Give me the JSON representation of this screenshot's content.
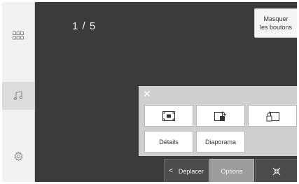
{
  "viewer": {
    "counter": "1 / 5"
  },
  "header": {
    "hide_line1": "Masquer",
    "hide_line2": "les boutons"
  },
  "options_panel": {
    "close_symbol": "✕",
    "details_label": "Détails",
    "slideshow_label": "Diaporama"
  },
  "bottom_bar": {
    "move_label": "Déplacer",
    "options_label": "Options"
  },
  "sidebar": {
    "items": [
      "grid-icon",
      "music-icon",
      "settings-icon"
    ]
  },
  "icons": {
    "fit": "fit-screen-icon",
    "rotate_right": "rotate-right-icon",
    "rotate_left": "rotate-left-icon",
    "collapse": "collapse-icon",
    "chevron": "chevron-left-icon"
  }
}
